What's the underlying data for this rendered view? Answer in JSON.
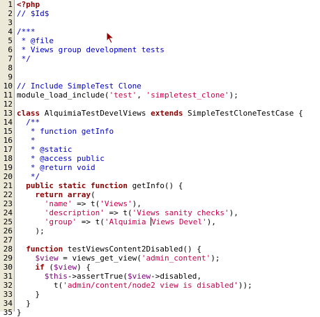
{
  "lines": [
    {
      "num": "1",
      "tokens": [
        {
          "t": "<?php",
          "c": "kw"
        }
      ]
    },
    {
      "num": "2",
      "tokens": [
        {
          "t": "// $Id$",
          "c": "cm"
        }
      ]
    },
    {
      "num": "3",
      "tokens": []
    },
    {
      "num": "4",
      "tokens": [
        {
          "t": "/***",
          "c": "cm"
        }
      ]
    },
    {
      "num": "5",
      "tokens": [
        {
          "t": " * @file",
          "c": "cm"
        }
      ]
    },
    {
      "num": "6",
      "tokens": [
        {
          "t": " * Views group development tests",
          "c": "cm"
        }
      ]
    },
    {
      "num": "7",
      "tokens": [
        {
          "t": " */",
          "c": "cm"
        }
      ]
    },
    {
      "num": "8",
      "tokens": []
    },
    {
      "num": "9",
      "tokens": []
    },
    {
      "num": "10",
      "tokens": [
        {
          "t": "// Include SimpleTest Clone",
          "c": "cm"
        }
      ]
    },
    {
      "num": "11",
      "tokens": [
        {
          "t": "module_load_include(",
          "c": "plain"
        },
        {
          "t": "'test'",
          "c": "str"
        },
        {
          "t": ", ",
          "c": "plain"
        },
        {
          "t": "'simpletest_clone'",
          "c": "str"
        },
        {
          "t": ");",
          "c": "plain"
        }
      ]
    },
    {
      "num": "12",
      "tokens": []
    },
    {
      "num": "13",
      "tokens": [
        {
          "t": "class",
          "c": "kw"
        },
        {
          "t": " AlquimiaTestDevelViews ",
          "c": "plain"
        },
        {
          "t": "extends",
          "c": "kw"
        },
        {
          "t": " SimpleTestCloneTestCase {",
          "c": "plain"
        }
      ]
    },
    {
      "num": "14",
      "tokens": [
        {
          "t": "  /**",
          "c": "cm"
        }
      ]
    },
    {
      "num": "15",
      "tokens": [
        {
          "t": "   * function getInfo",
          "c": "cm"
        }
      ]
    },
    {
      "num": "16",
      "tokens": [
        {
          "t": "   *",
          "c": "cm"
        }
      ]
    },
    {
      "num": "17",
      "tokens": [
        {
          "t": "   * @static",
          "c": "cm"
        }
      ]
    },
    {
      "num": "18",
      "tokens": [
        {
          "t": "   * @access public",
          "c": "cm"
        }
      ]
    },
    {
      "num": "19",
      "tokens": [
        {
          "t": "   * @return void",
          "c": "cm"
        }
      ]
    },
    {
      "num": "20",
      "tokens": [
        {
          "t": "   */",
          "c": "cm"
        }
      ]
    },
    {
      "num": "21",
      "tokens": [
        {
          "t": "  ",
          "c": "plain"
        },
        {
          "t": "public static function",
          "c": "kw"
        },
        {
          "t": " getInfo() {",
          "c": "plain"
        }
      ]
    },
    {
      "num": "22",
      "tokens": [
        {
          "t": "    ",
          "c": "plain"
        },
        {
          "t": "return array",
          "c": "kw"
        },
        {
          "t": "(",
          "c": "plain"
        }
      ]
    },
    {
      "num": "23",
      "tokens": [
        {
          "t": "      ",
          "c": "plain"
        },
        {
          "t": "'name'",
          "c": "str"
        },
        {
          "t": " => t(",
          "c": "plain"
        },
        {
          "t": "'Views'",
          "c": "str"
        },
        {
          "t": "),",
          "c": "plain"
        }
      ]
    },
    {
      "num": "24",
      "tokens": [
        {
          "t": "      ",
          "c": "plain"
        },
        {
          "t": "'description'",
          "c": "str"
        },
        {
          "t": " => t(",
          "c": "plain"
        },
        {
          "t": "'Views sanity checks'",
          "c": "str"
        },
        {
          "t": "),",
          "c": "plain"
        }
      ]
    },
    {
      "num": "25",
      "tokens": [
        {
          "t": "      ",
          "c": "plain"
        },
        {
          "t": "'group'",
          "c": "str"
        },
        {
          "t": " => t(",
          "c": "plain"
        },
        {
          "t": "'Alquimia ",
          "c": "str"
        },
        {
          "t": "",
          "c": "caret"
        },
        {
          "t": "Views Devel'",
          "c": "str"
        },
        {
          "t": "),",
          "c": "plain"
        }
      ]
    },
    {
      "num": "26",
      "tokens": [
        {
          "t": "    );",
          "c": "plain"
        }
      ]
    },
    {
      "num": "27",
      "tokens": []
    },
    {
      "num": "28",
      "tokens": [
        {
          "t": "  ",
          "c": "plain"
        },
        {
          "t": "function",
          "c": "kw"
        },
        {
          "t": " testViewsContent2Disabled() {",
          "c": "plain"
        }
      ]
    },
    {
      "num": "29",
      "tokens": [
        {
          "t": "    ",
          "c": "plain"
        },
        {
          "t": "$view",
          "c": "var"
        },
        {
          "t": " = views_get_view(",
          "c": "plain"
        },
        {
          "t": "'admin_content'",
          "c": "str"
        },
        {
          "t": ");",
          "c": "plain"
        }
      ]
    },
    {
      "num": "30",
      "tokens": [
        {
          "t": "    ",
          "c": "plain"
        },
        {
          "t": "if",
          "c": "kw"
        },
        {
          "t": " (",
          "c": "plain"
        },
        {
          "t": "$view",
          "c": "var"
        },
        {
          "t": ") {",
          "c": "plain"
        }
      ]
    },
    {
      "num": "31",
      "tokens": [
        {
          "t": "      ",
          "c": "plain"
        },
        {
          "t": "$this",
          "c": "var"
        },
        {
          "t": "->assertTrue(",
          "c": "plain"
        },
        {
          "t": "$view",
          "c": "var"
        },
        {
          "t": "->disabled,",
          "c": "plain"
        }
      ]
    },
    {
      "num": "32",
      "tokens": [
        {
          "t": "        t(",
          "c": "plain"
        },
        {
          "t": "'admin/content/node2 view is disabled'",
          "c": "str"
        },
        {
          "t": "));",
          "c": "plain"
        }
      ]
    },
    {
      "num": "33",
      "tokens": [
        {
          "t": "    }",
          "c": "plain"
        }
      ]
    },
    {
      "num": "34",
      "tokens": [
        {
          "t": "  }",
          "c": "plain"
        }
      ]
    },
    {
      "num": "35",
      "tokens": [
        {
          "t": "}",
          "c": "plain"
        }
      ]
    }
  ],
  "colors": {
    "keyword": "#8b0000",
    "comment": "#0000c8",
    "string": "#c8004a",
    "variable": "#7a007a",
    "gutter": "#ece9d8"
  },
  "icons": {
    "mouse": "mouse-pointer-icon"
  }
}
